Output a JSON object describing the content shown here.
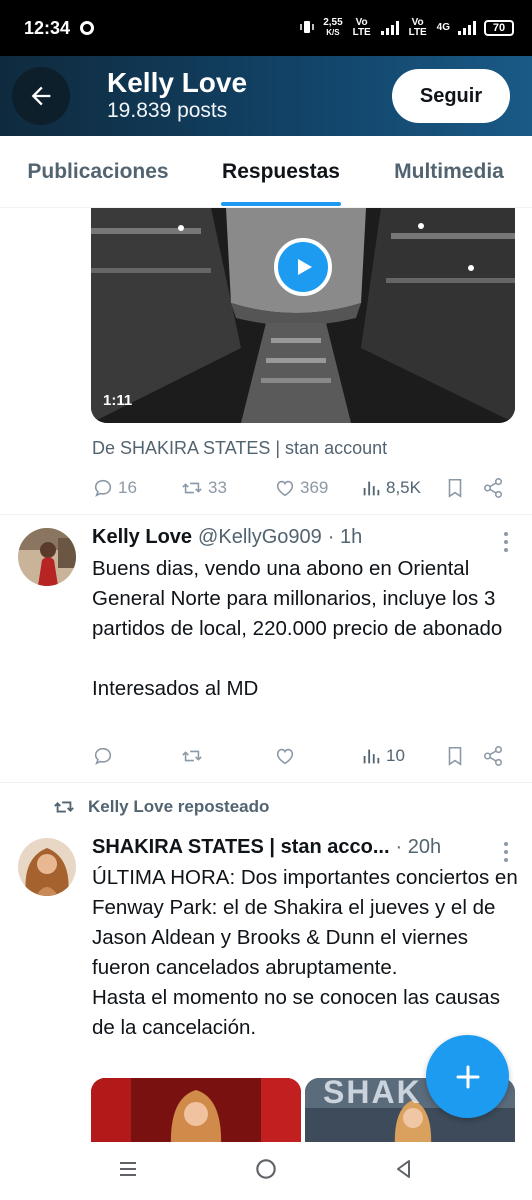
{
  "status_bar": {
    "time": "12:34",
    "net_speed": "2,55",
    "net_unit": "K/S",
    "lte1": "Vo LTE",
    "lte2": "Vo LTE",
    "net_type": "4G",
    "battery": "70"
  },
  "header": {
    "title": "Kelly Love",
    "posts": "19.839 posts",
    "follow_label": "Seguir"
  },
  "tabs": [
    {
      "label": "Publicaciones"
    },
    {
      "label": "Respuestas"
    },
    {
      "label": "Multimedia"
    }
  ],
  "video_tweet": {
    "duration": "1:11",
    "source": "De SHAKIRA STATES | stan account",
    "replies": "16",
    "reposts": "33",
    "likes": "369",
    "views": "8,5K"
  },
  "tweet1": {
    "display_name": "Kelly Love",
    "handle": "@KellyGo909",
    "time": "· 1h",
    "text": "Buens dias, vendo una abono en Oriental General Norte para millonarios, incluye los 3 partidos de local, 220.000 precio de abonado\n\nInteresados al MD",
    "views": "10"
  },
  "repost_label": "Kelly Love reposteado",
  "tweet2": {
    "display_name": "SHAKIRA STATES | stan acco...",
    "time": "· 20h",
    "text": "ÚLTIMA HORA: Dos importantes conciertos en Fenway Park: el de Shakira el jueves y el de Jason Aldean y Brooks & Dunn el viernes fueron cancelados abruptamente.\nHasta el momento no se conocen las causas de la cancelación.",
    "media_text": "SHAK"
  },
  "colors": {
    "accent": "#1d9bf0",
    "header_start": "#0f2a3d",
    "header_end": "#1a5a86",
    "muted": "#536471"
  }
}
